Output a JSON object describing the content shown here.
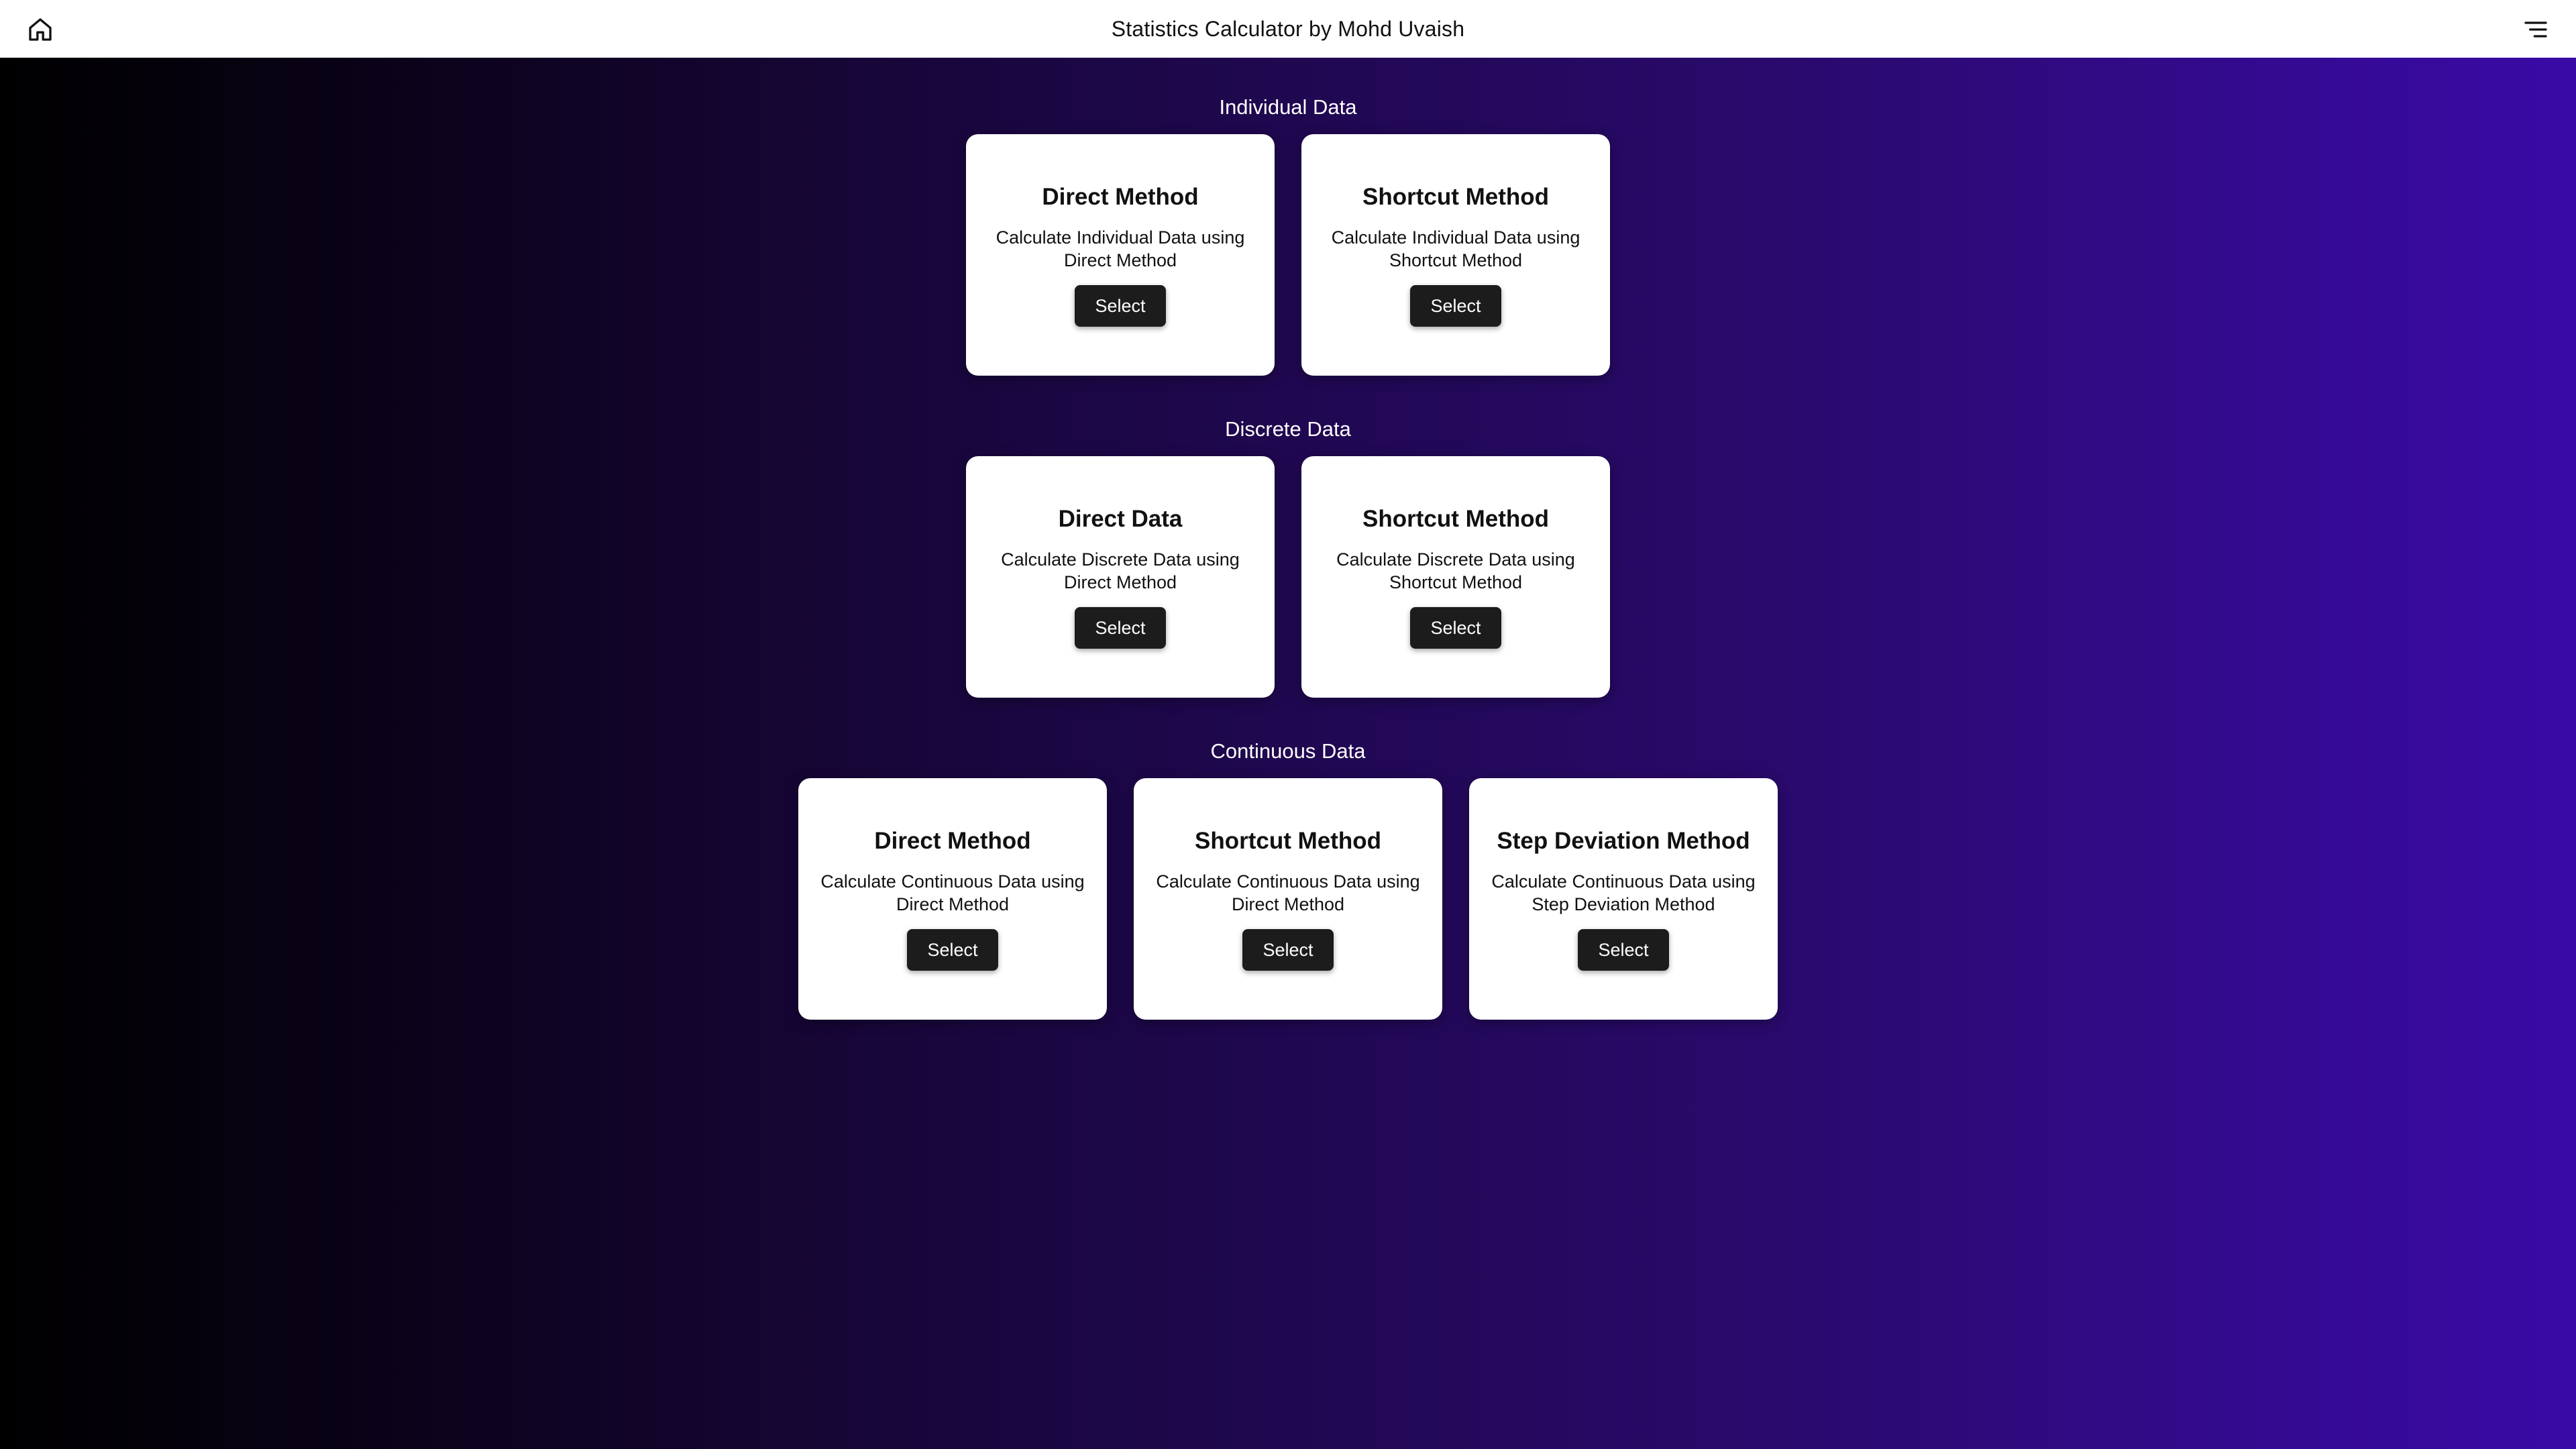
{
  "header": {
    "title": "Statistics Calculator by Mohd Uvaish",
    "home_icon": "home-icon",
    "menu_icon": "menu-icon"
  },
  "sections": [
    {
      "title": "Individual Data",
      "cards": [
        {
          "title": "Direct Method",
          "description": "Calculate Individual Data using Direct Method",
          "button": "Select"
        },
        {
          "title": "Shortcut Method",
          "description": "Calculate Individual Data using Shortcut Method",
          "button": "Select"
        }
      ]
    },
    {
      "title": "Discrete Data",
      "cards": [
        {
          "title": "Direct Data",
          "description": "Calculate Discrete Data using Direct Method",
          "button": "Select"
        },
        {
          "title": "Shortcut Method",
          "description": "Calculate Discrete Data using Shortcut Method",
          "button": "Select"
        }
      ]
    },
    {
      "title": "Continuous Data",
      "cards": [
        {
          "title": "Direct Method",
          "description": "Calculate Continuous Data using Direct Method",
          "button": "Select"
        },
        {
          "title": "Shortcut Method",
          "description": "Calculate Continuous Data using Direct Method",
          "button": "Select"
        },
        {
          "title": "Step Deviation Method",
          "description": "Calculate Continuous Data using Step Deviation Method",
          "button": "Select"
        }
      ]
    }
  ]
}
